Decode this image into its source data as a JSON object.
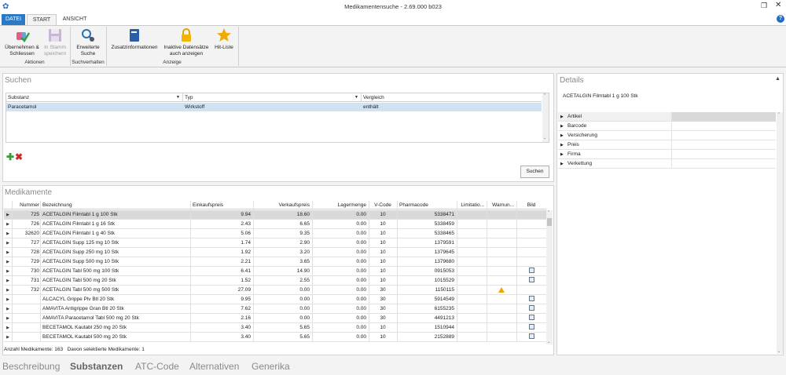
{
  "window": {
    "title": "Medikamentensuche - 2.69.000 b023"
  },
  "ribbon_tabs": {
    "datei": "DATEI",
    "start": "START",
    "ansicht": "ANSICHT"
  },
  "ribbon": {
    "uebernehmen": "Übernehmen &\nSchliessen",
    "instamm": "In Stamm\nspeichern",
    "erweiterte": "Erweiterte\nSuche",
    "zusatz": "Zusatzinformationen",
    "inaktive": "Inaktive Datensätze\nauch anzeigen",
    "hitliste": "Hit-Liste",
    "group_aktionen": "Aktionen",
    "group_suchverhalten": "Suchverhalten",
    "group_anzeige": "Anzeige"
  },
  "suchen": {
    "title": "Suchen",
    "columns": [
      "Substanz",
      "Typ",
      "Vergleich"
    ],
    "rows": [
      {
        "substanz": "Paracetamol",
        "typ": "Wirkstoff",
        "vergleich": "enthält"
      }
    ],
    "button": "Suchen"
  },
  "medikamente": {
    "title": "Medikamente",
    "columns": [
      "Nummer",
      "Bezeichnung",
      "Einkaufspreis",
      "Verkaufspreis",
      "Lagermenge",
      "V-Code",
      "Pharmacode",
      "Limitatio...",
      "Warnun...",
      "Bild"
    ],
    "rows": [
      {
        "nr": "725",
        "bez": "ACETALGIN Filmtabl 1 g 100 Stk",
        "ek": "9.94",
        "vk": "18.60",
        "lager": "0.00",
        "vcode": "10",
        "pharma": "5338471",
        "warn": false,
        "bild": false
      },
      {
        "nr": "726",
        "bez": "ACETALGIN Filmtabl 1 g 16 Stk",
        "ek": "2.43",
        "vk": "6.65",
        "lager": "0.00",
        "vcode": "10",
        "pharma": "5338459",
        "warn": false,
        "bild": false
      },
      {
        "nr": "32620",
        "bez": "ACETALGIN Filmtabl 1 g 40 Stk",
        "ek": "5.06",
        "vk": "9.35",
        "lager": "0.00",
        "vcode": "10",
        "pharma": "5338465",
        "warn": false,
        "bild": false
      },
      {
        "nr": "727",
        "bez": "ACETALGIN Supp 125 mg 10 Stk",
        "ek": "1.74",
        "vk": "2.90",
        "lager": "0.00",
        "vcode": "10",
        "pharma": "1379591",
        "warn": false,
        "bild": false
      },
      {
        "nr": "728",
        "bez": "ACETALGIN Supp 250 mg 10 Stk",
        "ek": "1.92",
        "vk": "3.20",
        "lager": "0.00",
        "vcode": "10",
        "pharma": "1379645",
        "warn": false,
        "bild": false
      },
      {
        "nr": "729",
        "bez": "ACETALGIN Supp 500 mg 10 Stk",
        "ek": "2.21",
        "vk": "3.65",
        "lager": "0.00",
        "vcode": "10",
        "pharma": "1379680",
        "warn": false,
        "bild": false
      },
      {
        "nr": "730",
        "bez": "ACETALGIN Tabl 500 mg 100 Stk",
        "ek": "6.41",
        "vk": "14.90",
        "lager": "0.00",
        "vcode": "10",
        "pharma": "0915053",
        "warn": false,
        "bild": true
      },
      {
        "nr": "731",
        "bez": "ACETALGIN Tabl 500 mg 20 Stk",
        "ek": "1.52",
        "vk": "2.55",
        "lager": "0.00",
        "vcode": "10",
        "pharma": "1015529",
        "warn": false,
        "bild": true
      },
      {
        "nr": "732",
        "bez": "ACETALGIN Tabl 500 mg 500 Stk",
        "ek": "27.09",
        "vk": "0.00",
        "lager": "0.00",
        "vcode": "30",
        "pharma": "1150115",
        "warn": true,
        "bild": false
      },
      {
        "nr": "",
        "bez": "ALCACYL Grippe Plv Btl 20 Stk",
        "ek": "9.95",
        "vk": "0.00",
        "lager": "0.00",
        "vcode": "30",
        "pharma": "5914549",
        "warn": false,
        "bild": true
      },
      {
        "nr": "",
        "bez": "AMAVITA Antigrippe Gran Btl 20 Stk",
        "ek": "7.62",
        "vk": "0.00",
        "lager": "0.00",
        "vcode": "30",
        "pharma": "6155235",
        "warn": false,
        "bild": true
      },
      {
        "nr": "",
        "bez": "AMAVITA Paracetamol Tabl 500 mg 20 Stk",
        "ek": "2.16",
        "vk": "0.00",
        "lager": "0.00",
        "vcode": "30",
        "pharma": "4491213",
        "warn": false,
        "bild": true
      },
      {
        "nr": "",
        "bez": "BECETAMOL Kautabl 250 mg 20 Stk",
        "ek": "3.40",
        "vk": "5.65",
        "lager": "0.00",
        "vcode": "10",
        "pharma": "1510944",
        "warn": false,
        "bild": true
      },
      {
        "nr": "",
        "bez": "BECETAMOL Kautabl 500 mg 20 Stk",
        "ek": "3.40",
        "vk": "5.65",
        "lager": "0.00",
        "vcode": "10",
        "pharma": "2152889",
        "warn": false,
        "bild": true
      }
    ],
    "status": "Anzahl Medikamente: 163   Davon selektierte Medikamente: 1"
  },
  "details": {
    "title": "Details",
    "heading": "ACETALGIN Filmtabl 1 g 100 Stk",
    "rows": [
      "Artikel",
      "Barcode",
      "Versicherung",
      "Preis",
      "Firma",
      "Verkettung"
    ]
  },
  "bottom_nav": [
    "Beschreibung",
    "Substanzen",
    "ATC-Code",
    "Alternativen",
    "Generika"
  ],
  "icons": {
    "uebernehmen": "check-pill-icon",
    "instamm": "save-icon",
    "erweiterte": "search-gear-icon",
    "zusatz": "book-icon",
    "inaktive": "lock-icon",
    "hitliste": "star-icon"
  }
}
